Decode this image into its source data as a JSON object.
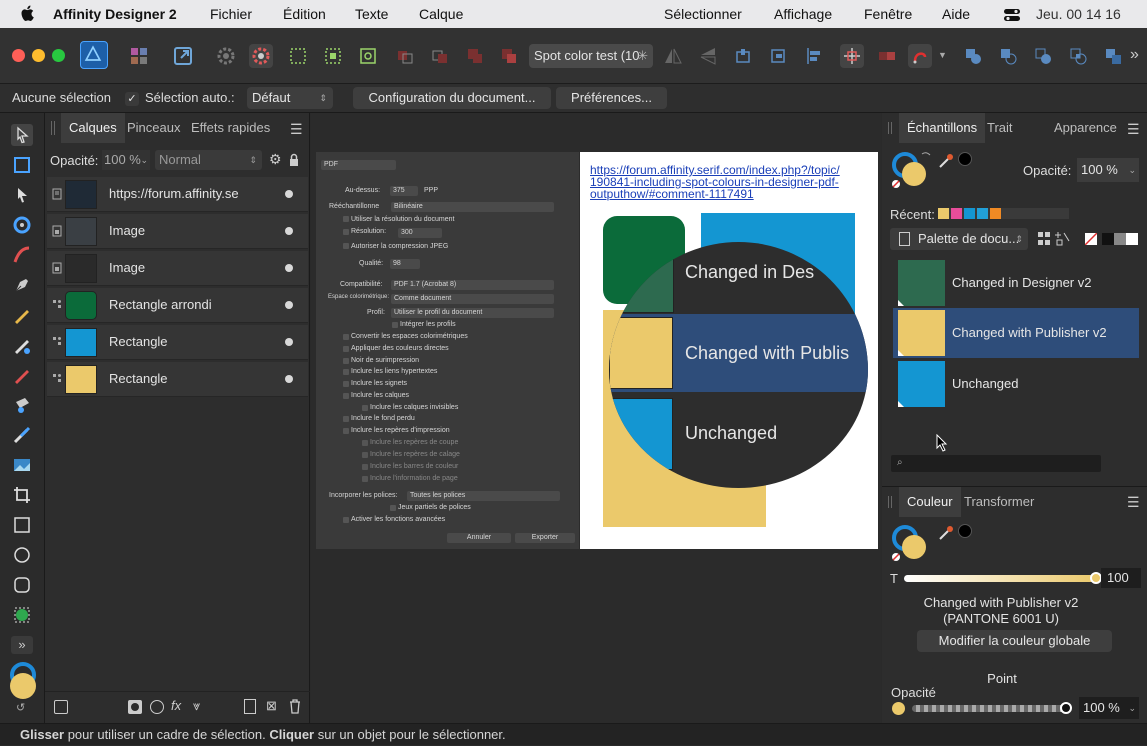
{
  "menubar": {
    "app_name": "Affinity Designer 2",
    "menus": [
      "Fichier",
      "Édition",
      "Texte",
      "Calque"
    ],
    "menus_right": [
      "Sélectionner",
      "Affichage",
      "Fenêtre",
      "Aide"
    ],
    "clock": "Jeu. 00 14 16"
  },
  "toolbar": {
    "document_tab": "Spot color test (10"
  },
  "context_bar": {
    "selection_label": "Aucune sélection",
    "auto_select_label": "Sélection auto.:",
    "auto_select_value": "Défaut",
    "doc_setup_label": "Configuration du document...",
    "prefs_label": "Préférences..."
  },
  "layers_panel": {
    "tabs": [
      "Calques",
      "Pinceaux",
      "Effets rapides"
    ],
    "opacity_label": "Opacité:",
    "opacity_value": "100 %",
    "blend_mode": "Normal",
    "layers": [
      {
        "name": "https://forum.affinity.se",
        "thumb_color": "#1f3f5c"
      },
      {
        "name": "Image",
        "thumb_color": "#3a3f44"
      },
      {
        "name": "Image",
        "thumb_color": "#2a2a2a"
      },
      {
        "name": "Rectangle arrondi",
        "thumb_color": "#0b6b3a"
      },
      {
        "name": "Rectangle",
        "thumb_color": "#1496d2"
      },
      {
        "name": "Rectangle",
        "thumb_color": "#ebc96b"
      }
    ]
  },
  "export_dialog": {
    "format": "PDF",
    "above_label": "Au-dessus:",
    "above_value": "375",
    "above_unit": "PPP",
    "resample_label": "Rééchantillonne",
    "resample_value": "Bilinéaire",
    "use_doc_res": "Utiliser la résolution du document",
    "resolution_label": "Résolution:",
    "resolution_value": "300",
    "allow_jpeg": "Autoriser la compression JPEG",
    "quality_label": "Qualité:",
    "quality_value": "98",
    "compat_label": "Compatibilité:",
    "compat_value": "PDF 1.7 (Acrobat 8)",
    "colorspace_label": "Espace colorimétrique:",
    "colorspace_value": "Comme document",
    "profile_label": "Profil:",
    "profile_value": "Utiliser le profil du document",
    "embed_profiles": "Intégrer les profils",
    "options": [
      "Convertir les espaces colorimétriques",
      "Appliquer des couleurs directes",
      "Noir de surimpression",
      "Inclure les liens hypertextes",
      "Inclure les signets",
      "Inclure les calques",
      "Inclure les calques invisibles",
      "Inclure le fond perdu",
      "Inclure les repères d'impression",
      "Inclure les repères de coupe",
      "Inclure les repères de calage",
      "Inclure les barres de couleur",
      "Inclure l'information de page"
    ],
    "fonts_label": "Incorporer les polices:",
    "fonts_value": "Toutes les polices",
    "partial_fonts": "Jeux partiels de polices",
    "advanced": "Activer les fonctions avancées",
    "cancel": "Annuler",
    "export": "Exporter"
  },
  "page": {
    "link_line1": "https://forum.affinity.serif.com/index.php?/topic/",
    "link_line2": "190841-including-spot-colours-in-designer-pdf-",
    "link_line3": "outputhow/#comment-1117491",
    "zoom_labels": [
      "Changed in Des",
      "Changed with Publis",
      "Unchanged"
    ]
  },
  "swatches_panel": {
    "tabs": [
      "Échantillons",
      "Trait",
      "Apparence"
    ],
    "opacity_label": "Opacité:",
    "opacity_value": "100 %",
    "recent_label": "Récent:",
    "palette_name": "Palette de docu...",
    "swatches": [
      {
        "name": "Changed in Designer v2",
        "color": "#2d6a4f"
      },
      {
        "name": "Changed with Publisher v2",
        "color": "#ebc96b"
      },
      {
        "name": "Unchanged",
        "color": "#1496d2"
      }
    ],
    "recent_colors": [
      "#ebc96b",
      "#e84d9a",
      "#1496d2",
      "#21a0d8",
      "#f08a24"
    ]
  },
  "color_panel": {
    "tabs": [
      "Couleur",
      "Transformer"
    ],
    "tint_label": "T",
    "tint_value": "100",
    "color_name": "Changed with Publisher v2",
    "pantone": "(PANTONE 6001 U)",
    "modify_button": "Modifier la couleur globale",
    "point_label": "Point",
    "opacity_label": "Opacité",
    "opacity_value": "100 %"
  },
  "status_bar": {
    "drag_word": "Glisser",
    "drag_text": " pour utiliser un cadre de sélection. ",
    "click_word": "Cliquer",
    "click_text": " sur un objet pour le sélectionner."
  },
  "colors": {
    "accent_blue": "#1e6fd9",
    "spot_yellow": "#ebc96b",
    "spot_blue": "#1496d2",
    "spot_green": "#0b6b3a",
    "selection_row": "#2e4d7a"
  }
}
